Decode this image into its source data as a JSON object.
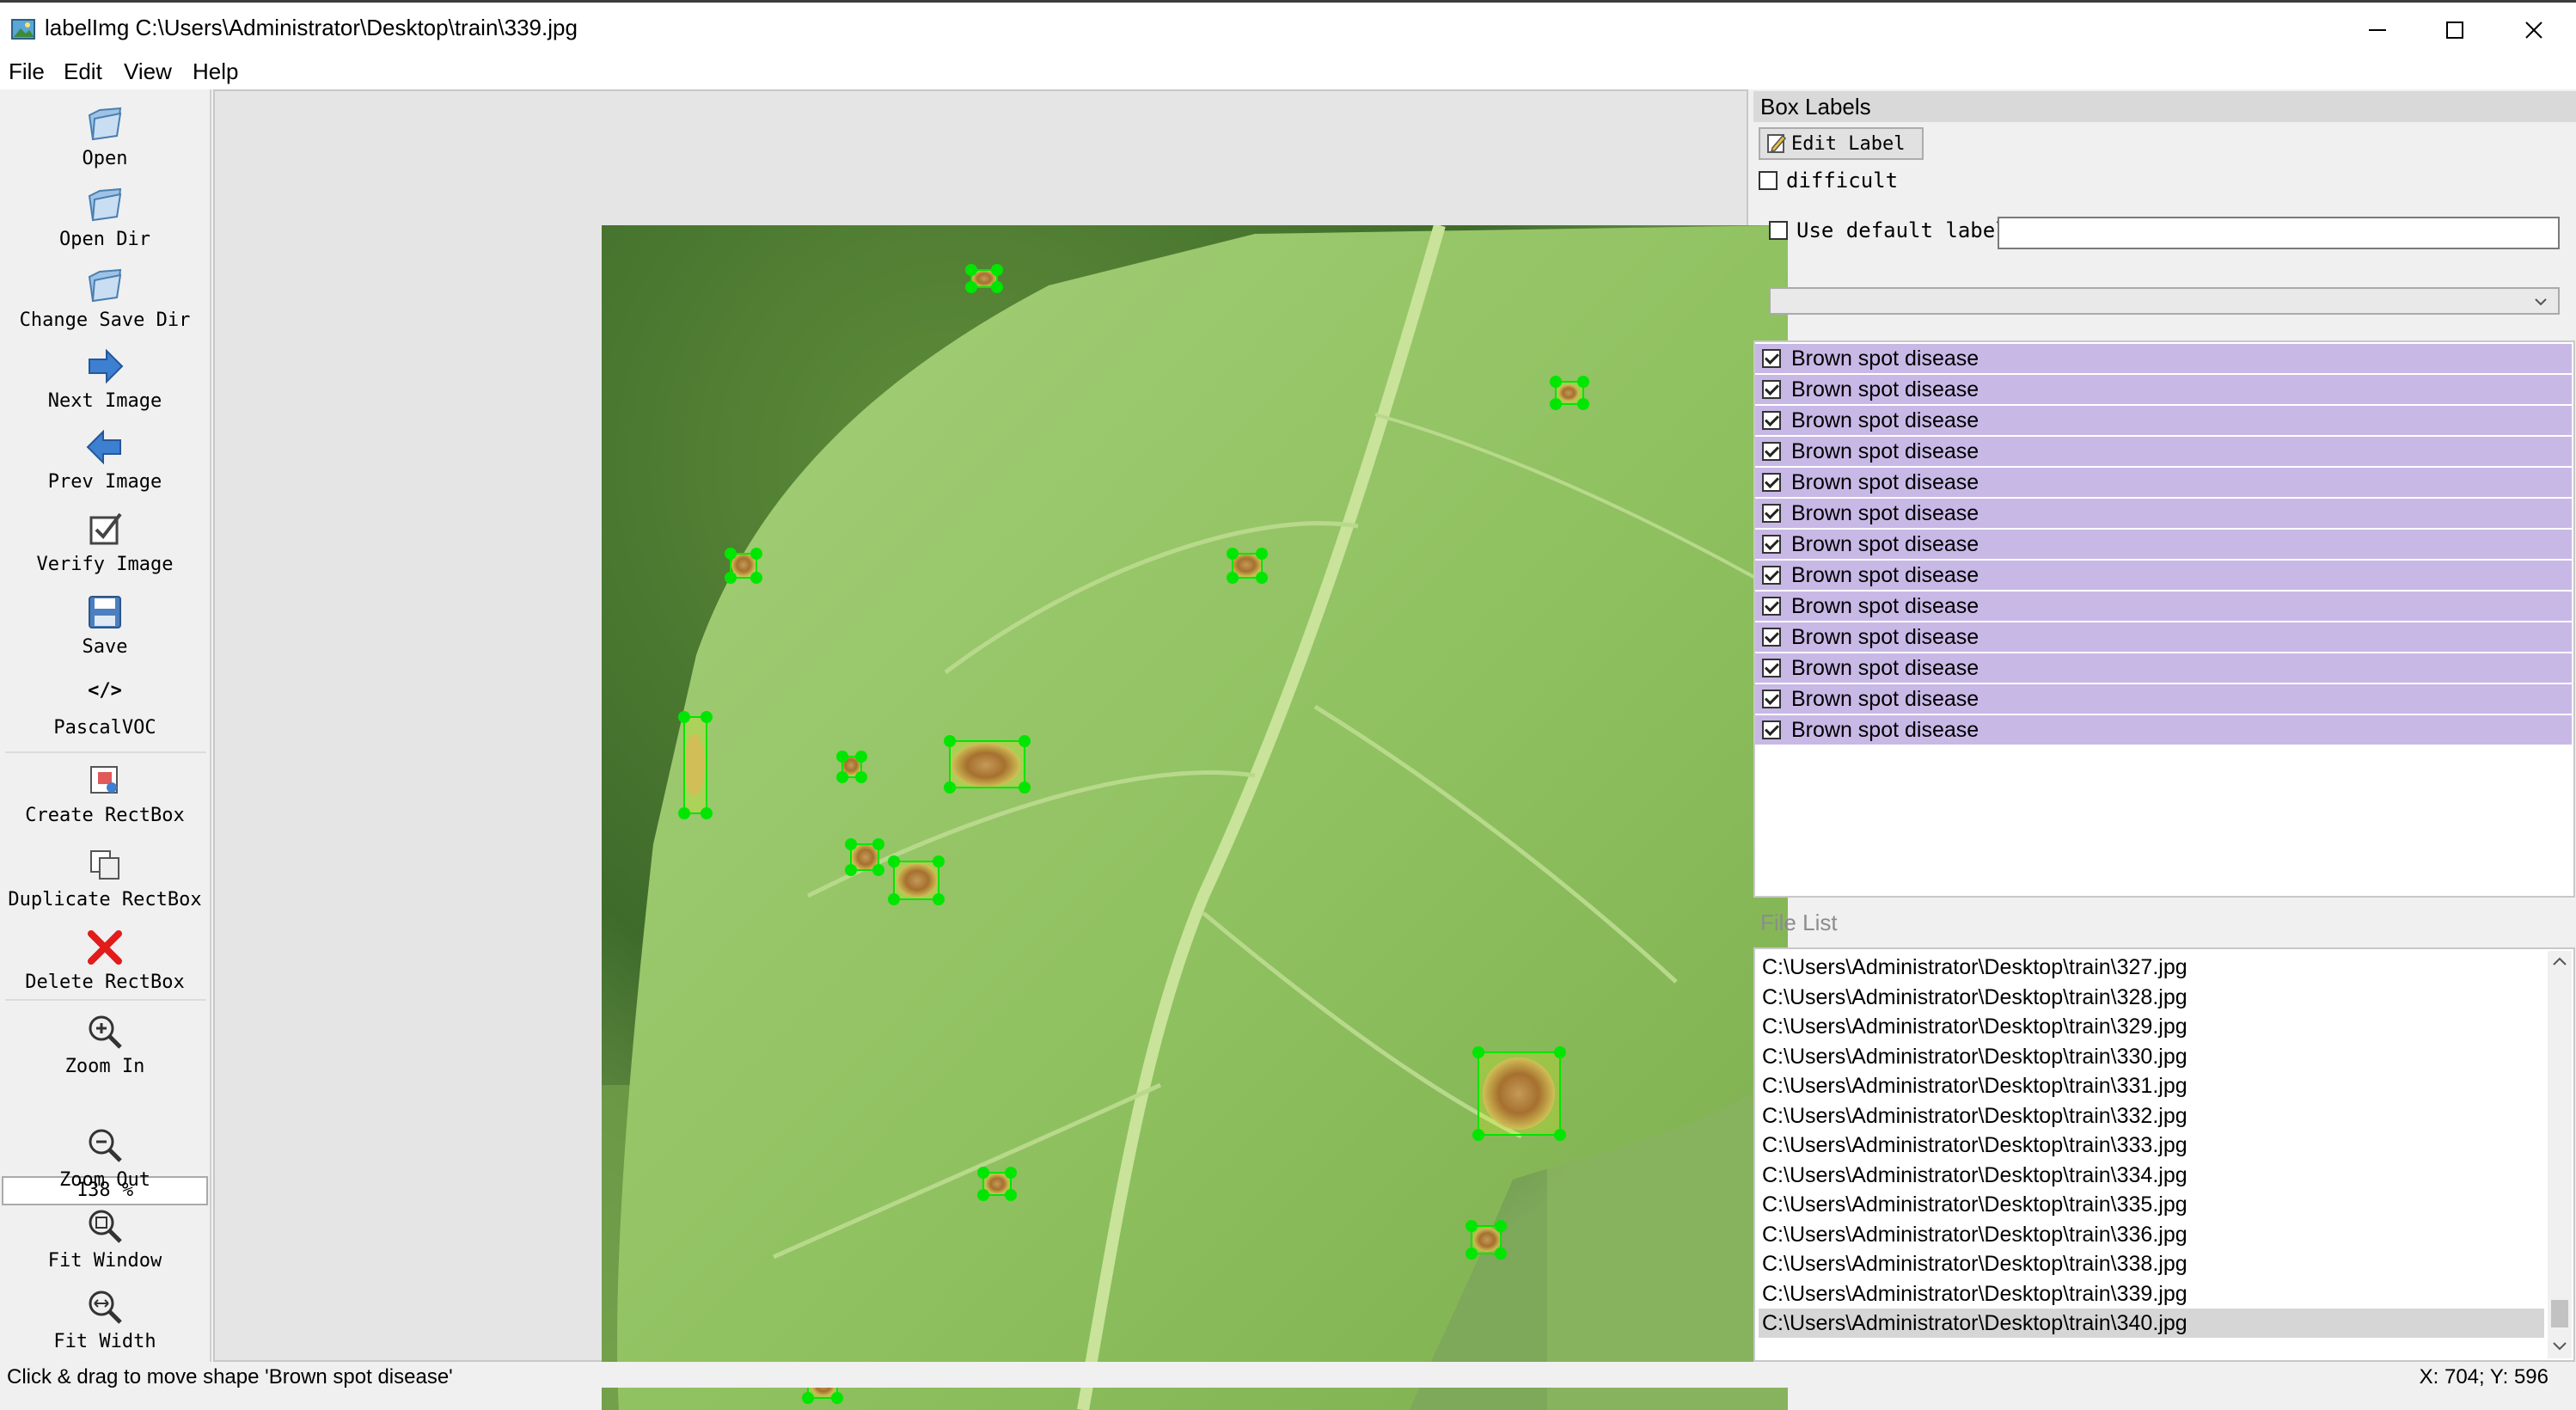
{
  "window": {
    "title": "labelImg C:\\Users\\Administrator\\Desktop\\train\\339.jpg"
  },
  "menu": [
    "File",
    "Edit",
    "View",
    "Help"
  ],
  "toolbar": {
    "open": "Open",
    "open_dir": "Open Dir",
    "change_save_dir": "Change Save Dir",
    "next_image": "Next Image",
    "prev_image": "Prev Image",
    "verify_image": "Verify Image",
    "save": "Save",
    "format_icon_text": "</>",
    "format": "PascalVOC",
    "create_rectbox": "Create RectBox",
    "duplicate_rectbox": "Duplicate RectBox",
    "delete_rectbox": "Delete RectBox",
    "zoom_in": "Zoom In",
    "zoom_value": "138 %",
    "zoom_out": "Zoom Out",
    "fit_window": "Fit Window",
    "fit_width": "Fit Width"
  },
  "box_labels": {
    "header": "Box Labels",
    "edit_label": "Edit Label",
    "difficult": "difficult",
    "use_default_label": "Use default label",
    "default_label_value": "",
    "items": [
      "Brown spot disease",
      "Brown spot disease",
      "Brown spot disease",
      "Brown spot disease",
      "Brown spot disease",
      "Brown spot disease",
      "Brown spot disease",
      "Brown spot disease",
      "Brown spot disease",
      "Brown spot disease",
      "Brown spot disease",
      "Brown spot disease",
      "Brown spot disease"
    ]
  },
  "file_list": {
    "header": "File List",
    "selected_index": 12,
    "files": [
      "C:\\Users\\Administrator\\Desktop\\train\\327.jpg",
      "C:\\Users\\Administrator\\Desktop\\train\\328.jpg",
      "C:\\Users\\Administrator\\Desktop\\train\\329.jpg",
      "C:\\Users\\Administrator\\Desktop\\train\\330.jpg",
      "C:\\Users\\Administrator\\Desktop\\train\\331.jpg",
      "C:\\Users\\Administrator\\Desktop\\train\\332.jpg",
      "C:\\Users\\Administrator\\Desktop\\train\\333.jpg",
      "C:\\Users\\Administrator\\Desktop\\train\\334.jpg",
      "C:\\Users\\Administrator\\Desktop\\train\\335.jpg",
      "C:\\Users\\Administrator\\Desktop\\train\\336.jpg",
      "C:\\Users\\Administrator\\Desktop\\train\\338.jpg",
      "C:\\Users\\Administrator\\Desktop\\train\\339.jpg",
      "C:\\Users\\Administrator\\Desktop\\train\\340.jpg"
    ]
  },
  "status": {
    "message": "Click & drag to move shape 'Brown spot disease'",
    "coords": "X: 704; Y: 596"
  },
  "colors": {
    "label_highlight": "#c8b8e6",
    "box_vertex": "#00e600",
    "selected_file": "#d6d6d6"
  }
}
